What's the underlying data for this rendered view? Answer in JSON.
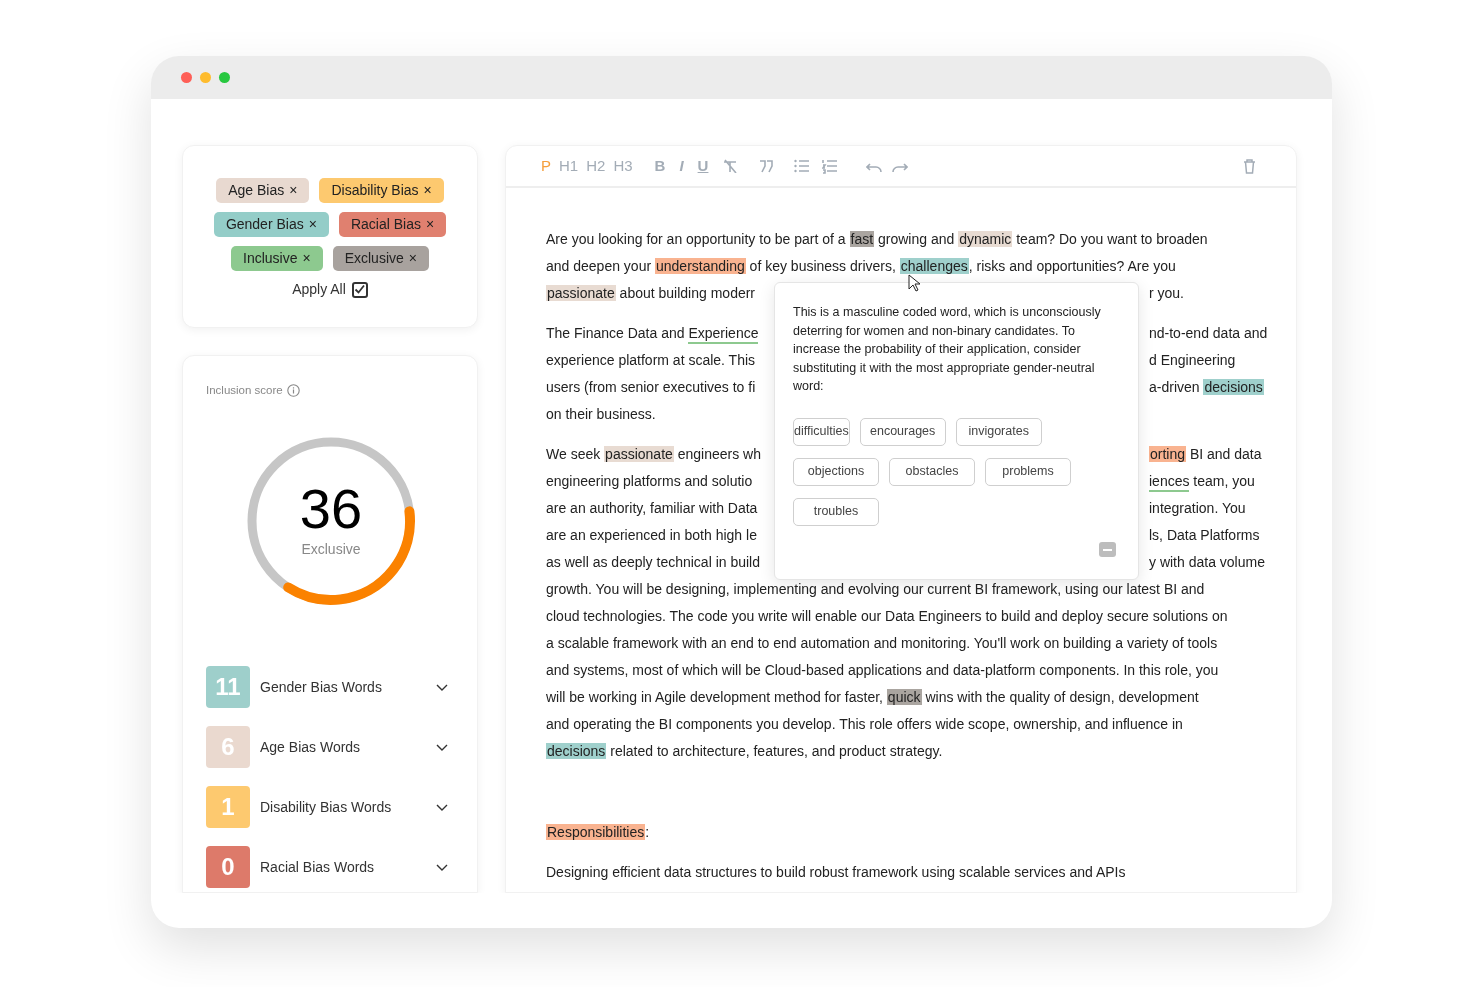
{
  "filters": [
    {
      "label": "Age Bias",
      "color": "#e8d9d0"
    },
    {
      "label": "Disability Bias",
      "color": "#fdc96f"
    },
    {
      "label": "Gender Bias",
      "color": "#94cdc8"
    },
    {
      "label": "Racial Bias",
      "color": "#e0806f"
    },
    {
      "label": "Inclusive",
      "color": "#8dc98f"
    },
    {
      "label": "Exclusive",
      "color": "#a8a29e"
    }
  ],
  "filter_remove": "×",
  "apply_all": {
    "label": "Apply All",
    "checked": true
  },
  "score": {
    "title": "Inclusion score",
    "value": "36",
    "label": "Exclusive",
    "level": 0.36
  },
  "bias_groups": [
    {
      "count": "11",
      "label": "Gender Bias Words",
      "color": "#9ecfcb",
      "expanded": false
    },
    {
      "count": "6",
      "label": "Age Bias Words",
      "color": "#ead9cf",
      "expanded": false
    },
    {
      "count": "1",
      "label": "Disability Bias Words",
      "color": "#fdc96f",
      "expanded": false
    },
    {
      "count": "0",
      "label": "Racial Bias Words",
      "color": "#dd7a6a",
      "expanded": false
    }
  ],
  "toolbar": {
    "blocks": [
      {
        "label": "P",
        "selected": true
      },
      {
        "label": "H1",
        "selected": false
      },
      {
        "label": "H2",
        "selected": false
      },
      {
        "label": "H3",
        "selected": false
      }
    ],
    "marks": [
      {
        "label": "B",
        "kind": "bold"
      },
      {
        "label": "I",
        "kind": "italic"
      },
      {
        "label": "U",
        "kind": "underline"
      }
    ]
  },
  "paragraphs": [
    {
      "lines": [
        {
          "left": [
            {
              "kind": "plain",
              "text": "Are you looking for an opportunity to be part of a "
            },
            {
              "kind": "highlight",
              "color": "#aaa5a0",
              "text": "fast"
            },
            {
              "kind": "plain",
              "text": " growing and "
            },
            {
              "kind": "highlight",
              "color": "#e8dbd2",
              "text": "dynamic"
            },
            {
              "kind": "plain",
              "text": " team? Do you want to broaden"
            }
          ]
        },
        {
          "left": [
            {
              "kind": "plain",
              "text": "and deepen your "
            },
            {
              "kind": "highlight",
              "color": "#f9b390",
              "text": "understanding"
            },
            {
              "kind": "plain",
              "text": " of key business drivers, "
            },
            {
              "kind": "highlight",
              "color": "#9fd0cc",
              "text": "challenges"
            },
            {
              "kind": "plain",
              "text": ", risks and opportunities? Are you"
            }
          ]
        },
        {
          "left": [
            {
              "kind": "highlight",
              "color": "#e8dbd2",
              "text": "passionate"
            },
            {
              "kind": "plain",
              "text": " about building moderr"
            }
          ],
          "right": [
            {
              "kind": "plain",
              "text": "r you."
            }
          ]
        }
      ]
    },
    {
      "lines": [
        {
          "left": [
            {
              "kind": "plain",
              "text": "The Finance Data and "
            },
            {
              "kind": "underline",
              "color": "#8dc98f",
              "text": "Experience"
            }
          ],
          "right": [
            {
              "kind": "plain",
              "text": "nd-to-end data and"
            }
          ]
        },
        {
          "left": [
            {
              "kind": "plain",
              "text": "experience platform at scale. This"
            }
          ],
          "right": [
            {
              "kind": "plain",
              "text": "d Engineering"
            }
          ]
        },
        {
          "left": [
            {
              "kind": "plain",
              "text": "users (from senior executives to fi"
            }
          ],
          "right": [
            {
              "kind": "plain",
              "text": "a-driven "
            },
            {
              "kind": "highlight",
              "color": "#9fd0cc",
              "text": "decisions"
            }
          ]
        },
        {
          "left": [
            {
              "kind": "plain",
              "text": "on their business."
            }
          ]
        }
      ]
    },
    {
      "lines": [
        {
          "left": [
            {
              "kind": "plain",
              "text": "We seek "
            },
            {
              "kind": "highlight",
              "color": "#e8dbd2",
              "text": "passionate"
            },
            {
              "kind": "plain",
              "text": " engineers wh"
            }
          ],
          "right": [
            {
              "kind": "highlight",
              "color": "#f9b390",
              "text": "orting"
            },
            {
              "kind": "plain",
              "text": " BI and data"
            }
          ]
        },
        {
          "left": [
            {
              "kind": "plain",
              "text": "engineering platforms and solutio"
            }
          ],
          "right": [
            {
              "kind": "underline",
              "color": "#8dc98f",
              "text": "iences"
            },
            {
              "kind": "plain",
              "text": " team, you"
            }
          ]
        },
        {
          "left": [
            {
              "kind": "plain",
              "text": "are an authority, familiar with Data"
            }
          ],
          "right": [
            {
              "kind": "plain",
              "text": "integration. You"
            }
          ]
        },
        {
          "left": [
            {
              "kind": "plain",
              "text": "are an experienced in both high le"
            }
          ],
          "right": [
            {
              "kind": "plain",
              "text": "ls, Data Platforms"
            }
          ]
        },
        {
          "left": [
            {
              "kind": "plain",
              "text": "as well as deeply technical in build"
            }
          ],
          "right": [
            {
              "kind": "plain",
              "text": "y with data volume"
            }
          ]
        },
        {
          "left": [
            {
              "kind": "plain",
              "text": "growth. You will be designing, implementing and evolving our current BI framework, using our latest BI and"
            }
          ]
        },
        {
          "left": [
            {
              "kind": "plain",
              "text": "cloud technologies. The code you write will enable our Data Engineers to build and deploy secure solutions on"
            }
          ]
        },
        {
          "left": [
            {
              "kind": "plain",
              "text": "a scalable framework with an end to end automation and monitoring. You'll work on building a variety of tools"
            }
          ]
        },
        {
          "left": [
            {
              "kind": "plain",
              "text": "and systems, most of which will be Cloud-based applications and data-platform components. In this role, you"
            }
          ]
        },
        {
          "left": [
            {
              "kind": "plain",
              "text": "will be working in Agile development method for faster, "
            },
            {
              "kind": "highlight",
              "color": "#aaa5a0",
              "text": "quick"
            },
            {
              "kind": "plain",
              "text": " wins with the quality of design, development"
            }
          ]
        },
        {
          "left": [
            {
              "kind": "plain",
              "text": "and operating the BI components you develop. This role offers wide scope, ownership, and influence in"
            }
          ]
        },
        {
          "left": [
            {
              "kind": "highlight",
              "color": "#9fd0cc",
              "text": "decisions"
            },
            {
              "kind": "plain",
              "text": " related to architecture, features, and product strategy."
            }
          ]
        }
      ]
    },
    {
      "lines": [
        {
          "left": [
            {
              "kind": "highlight",
              "color": "#f9b390",
              "text": "Responsibilities"
            },
            {
              "kind": "plain",
              "text": ":"
            }
          ]
        }
      ]
    },
    {
      "lines": [
        {
          "left": [
            {
              "kind": "plain",
              "text": "Designing efficient data structures to build robust framework using scalable services and APIs"
            }
          ]
        }
      ]
    }
  ],
  "popup": {
    "message": "This is a masculine coded word, which is unconsciously deterring for women and non-binary candidates. To increase the probability of their application, consider substituting it with the most appropriate gender-neutral word:",
    "suggestions": [
      "difficulties",
      "encourages",
      "invigorates",
      "objections",
      "obstacles",
      "problems",
      "troubles"
    ]
  }
}
